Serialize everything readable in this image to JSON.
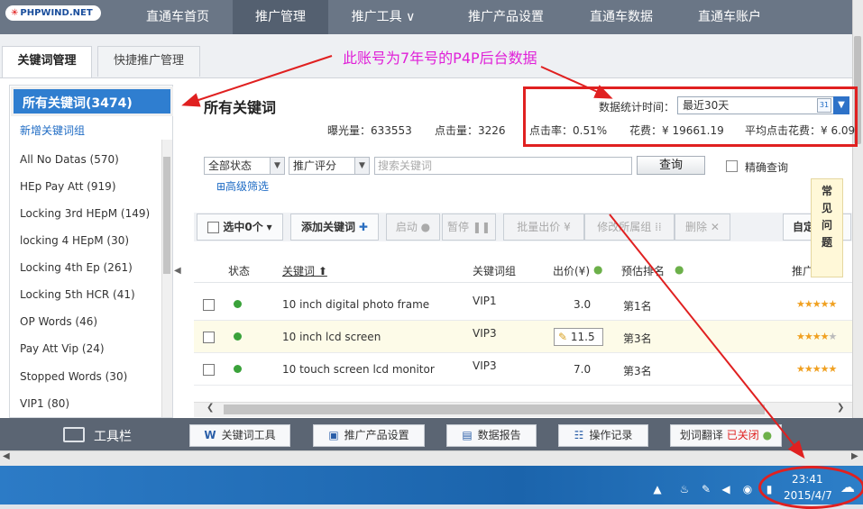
{
  "brand": {
    "logo": "PHPWIND.NET"
  },
  "nav": {
    "items": [
      "直通车首页",
      "推广管理",
      "推广工具 ∨",
      "推广产品设置",
      "直通车数据",
      "直通车账户"
    ]
  },
  "tabs": [
    "关键词管理",
    "快捷推广管理"
  ],
  "annotation": "此账号为7年号的P4P后台数据",
  "sidebar": {
    "header": "所有关键词(3474)",
    "new_group": "新增关键词组",
    "items": [
      "All No Datas (570)",
      "HEp Pay Att (919)",
      "Locking 3rd HEpM (149)",
      "locking 4 HEpM (30)",
      "Locking 4th Ep (261)",
      "Locking 5th HCR (41)",
      "OP Words (46)",
      "Pay Att Vip (24)",
      "Stopped Words (30)",
      "VIP1 (80)"
    ]
  },
  "main": {
    "title": "所有关键词",
    "impressions": "曝光量：633553",
    "clicks": "点击量：3226",
    "ctr": "点击率：0.51%",
    "cost": "花费：¥ 19661.19",
    "avg_cpc": "平均点击花费：¥ 6.09",
    "date_label": "数据统计时间：",
    "date_range": "最近30天",
    "calendar": "31"
  },
  "filters": {
    "status": "全部状态",
    "score": "推广评分",
    "search_placeholder": "搜索关键词",
    "query_btn": "查询",
    "exact": "精确查询",
    "advanced": "⊞高级筛选"
  },
  "toolbar": {
    "selected": "选中0个",
    "add": "添加关键词",
    "start": "启动",
    "pause": "暂停",
    "bulk_bid": "批量出价",
    "change_group": "修改所属组",
    "delete": "删除",
    "custom": "自定"
  },
  "table": {
    "headers": [
      "状态",
      "关键词 ⬆",
      "关键词组",
      "出价(¥)",
      "预估排名",
      "推广"
    ],
    "rows": [
      {
        "keyword": "10 inch digital photo frame",
        "group": "VIP1",
        "bid": "3.0",
        "rank": "第1名",
        "stars": 5
      },
      {
        "keyword": "10 inch lcd screen",
        "group": "VIP3",
        "bid": "11.5",
        "rank": "第3名",
        "stars": 4
      },
      {
        "keyword": "10 touch screen lcd monitor",
        "group": "VIP3",
        "bid": "7.0",
        "rank": "第3名",
        "stars": 5
      }
    ]
  },
  "faq": "常见问题",
  "bottombar": {
    "title": "工具栏",
    "buttons": [
      "关键词工具",
      "推广产品设置",
      "数据报告",
      "操作记录",
      "划词翻译"
    ],
    "translate_status": "已关闭"
  },
  "taskbar": {
    "time": "23:41",
    "date": "2015/4/7"
  },
  "colors": {
    "nav": "#6a7686",
    "accent": "#2f7ed0",
    "highlight": "#e02020",
    "annotation": "#e020d8"
  }
}
